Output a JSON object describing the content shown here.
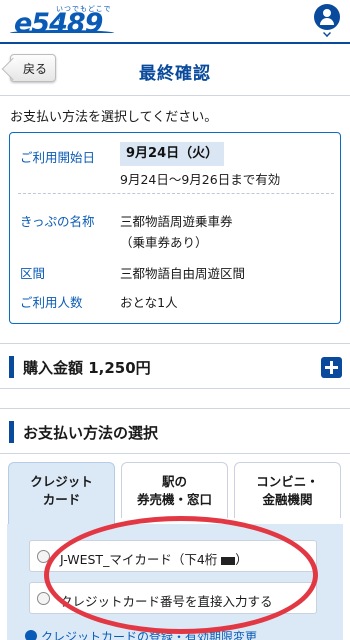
{
  "header": {
    "logo_text": "e5489",
    "logo_sub": "いつでもどこでも"
  },
  "titlebar": {
    "back_label": "戻る",
    "title": "最終確認"
  },
  "instruction": "お支払い方法を選択してください。",
  "summary": {
    "start_label": "ご利用開始日",
    "start_date": "9月24日（火）",
    "validity": "9月24日～9月26日まで有効",
    "ticket_label": "きっぷの名称",
    "ticket_name_line1": "三都物語周遊乗車券",
    "ticket_name_line2": "（乗車券あり）",
    "section_label": "区間",
    "section_value": "三都物語自由周遊区間",
    "people_label": "ご利用人数",
    "people_value": "おとな1人"
  },
  "purchase": {
    "title": "購入金額 1,250円"
  },
  "payment": {
    "title": "お支払い方法の選択",
    "tabs": [
      {
        "label": "クレジット\nカード",
        "active": true
      },
      {
        "label": "駅の\n券売機・窓口",
        "active": false
      },
      {
        "label": "コンビニ・\n金融機関",
        "active": false
      }
    ],
    "options": [
      {
        "label": "J-WEST_マイカード（下4桁",
        "suffix": "）",
        "selected": false
      },
      {
        "label": "クレジットカード番号を直接入力する",
        "selected": false
      }
    ],
    "link_text": "クレジットカードの登録・有効期限変更"
  },
  "colors": {
    "brand": "#0a4a9c",
    "link": "#0a5bb5",
    "panel": "#dbe9f7",
    "annotation": "#e23844"
  }
}
